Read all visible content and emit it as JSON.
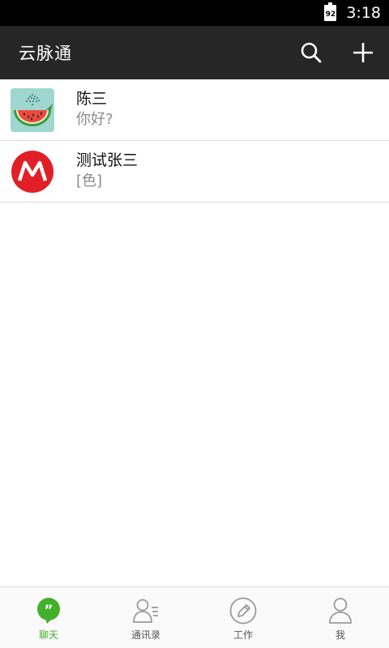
{
  "status_bar": {
    "battery_level": "92",
    "time": "3:18"
  },
  "app_bar": {
    "title": "云脉通"
  },
  "conversations": [
    {
      "name": "陈三",
      "preview": "你好?",
      "avatar": "watermelon-whale-avatar"
    },
    {
      "name": "测试张三",
      "preview": "[色]",
      "avatar": "motorola-logo-avatar"
    }
  ],
  "bottom_nav": {
    "tabs": [
      {
        "label": "聊天",
        "icon": "chat-bubble-icon",
        "active": true
      },
      {
        "label": "通讯录",
        "icon": "contacts-icon",
        "active": false
      },
      {
        "label": "工作",
        "icon": "pencil-circle-icon",
        "active": false
      },
      {
        "label": "我",
        "icon": "person-icon",
        "active": false
      }
    ]
  },
  "colors": {
    "app_bar": "#262626",
    "active_tab": "#43b02a",
    "inactive_icon": "#9a9a9a",
    "motorola_red": "#e21f26",
    "avatar_teal": "#9fd6cf"
  }
}
